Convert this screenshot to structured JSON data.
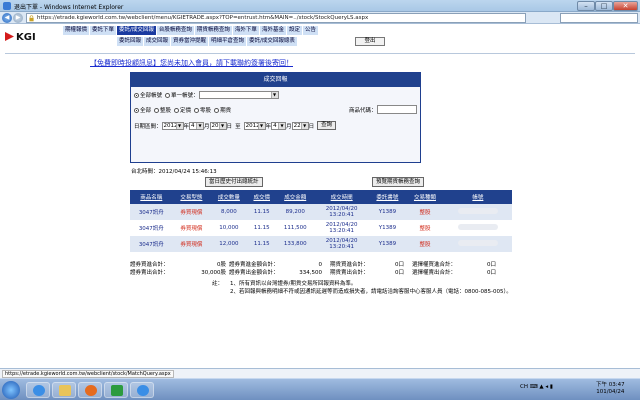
{
  "window": {
    "title": "退出下單 - Windows Internet Explorer",
    "minimize": "–",
    "maximize": "□",
    "close": "✕"
  },
  "browser": {
    "url": "https://etrade.kgieworld.com.tw/webclient/menu/KGIETRADE.aspx?TOP=entrust.htm&MAIN=../stock/StockQueryLS.aspx"
  },
  "site": {
    "logo": "KGI",
    "menu_main": [
      "期權報價",
      "委託下單",
      "委託/成交回報",
      "台股帳務查詢",
      "期貨帳務查詢",
      "海外下單",
      "海外基金",
      "設定",
      "公告"
    ],
    "menu_sub": [
      "委託回報",
      "成交回報",
      "資券當沖提醒",
      "明細平倉查詢",
      "委託/成交回報總表"
    ],
    "logout": "登出",
    "banner": "【免費即時投顧訊息】您尚未加入會員，請下載聯約簽署後寄回！"
  },
  "query": {
    "panel_title": "成交回報",
    "account_all": "全部帳號",
    "account_single": "單一帳號：",
    "account_value": "",
    "types": [
      "全部",
      "整股",
      "定價",
      "零股",
      "期貨"
    ],
    "stock_code_label": "商品代碼：",
    "date_label": "日期區間：",
    "from": {
      "year": "2012",
      "year_unit": "年",
      "month": "4",
      "month_unit": "月",
      "day": "20",
      "day_unit": "日"
    },
    "to_label": "至",
    "to": {
      "year": "2012",
      "year_unit": "年",
      "month": "4",
      "month_unit": "月",
      "day": "22",
      "day_unit": "日"
    },
    "query_button": "查詢"
  },
  "results": {
    "timestamp": "台北時間：2012/04/24 15:46:13",
    "btn_today": "當日歷史付出總統計",
    "btn_detail": "預覽期貨帳務查詢",
    "headers": [
      "商品名稱",
      "交易型態",
      "成交數量",
      "成交價",
      "成交金額",
      "成交時間",
      "委託書號",
      "交易種類",
      "帳號"
    ],
    "rows": [
      {
        "name": "3047訊舟",
        "type": "券買現償",
        "qty": "8,000",
        "price": "11.15",
        "amount": "89,200",
        "date": "2012/04/20",
        "time": "13:20:41",
        "order_no": "Y1389",
        "kind": "整股"
      },
      {
        "name": "3047訊舟",
        "type": "券買現償",
        "qty": "10,000",
        "price": "11.15",
        "amount": "111,500",
        "date": "2012/04/20",
        "time": "13:20:41",
        "order_no": "Y1389",
        "kind": "整股"
      },
      {
        "name": "3047訊舟",
        "type": "券買現償",
        "qty": "12,000",
        "price": "11.15",
        "amount": "133,800",
        "date": "2012/04/20",
        "time": "13:20:41",
        "order_no": "Y1389",
        "kind": "整股"
      }
    ],
    "sums": [
      {
        "a": "證券買進合計：",
        "b": "0股",
        "c": "證券賣進金額合計：",
        "d": "0",
        "e": "期貨買進合計：",
        "f": "0口",
        "g": "選擇權買進合計：",
        "h": "0口"
      },
      {
        "a": "證券賣出合計：",
        "b": "30,000股",
        "c": "證券賣出金額合計：",
        "d": "334,500",
        "e": "期貨賣出合計：",
        "f": "0口",
        "g": "選擇權賣出合計：",
        "h": "0口"
      }
    ],
    "note_label": "註：",
    "notes": [
      "1、所有資訊以台灣證券/期貨交易所回報資料為準。",
      "2、若回報與帳務明細不符或因通訊延遲等而造成損失者，請電話洽詢客服中心客服人員（電話：0800-085-005）。"
    ]
  },
  "status": {
    "url": "https://etrade.kgieworld.com.tw/webclient/stock/MatchQuery.aspx"
  },
  "taskbar": {
    "tray": "CH ⌨ ▲ ◂ ▮",
    "time": "下午 03:47",
    "date": "101/04/24"
  }
}
